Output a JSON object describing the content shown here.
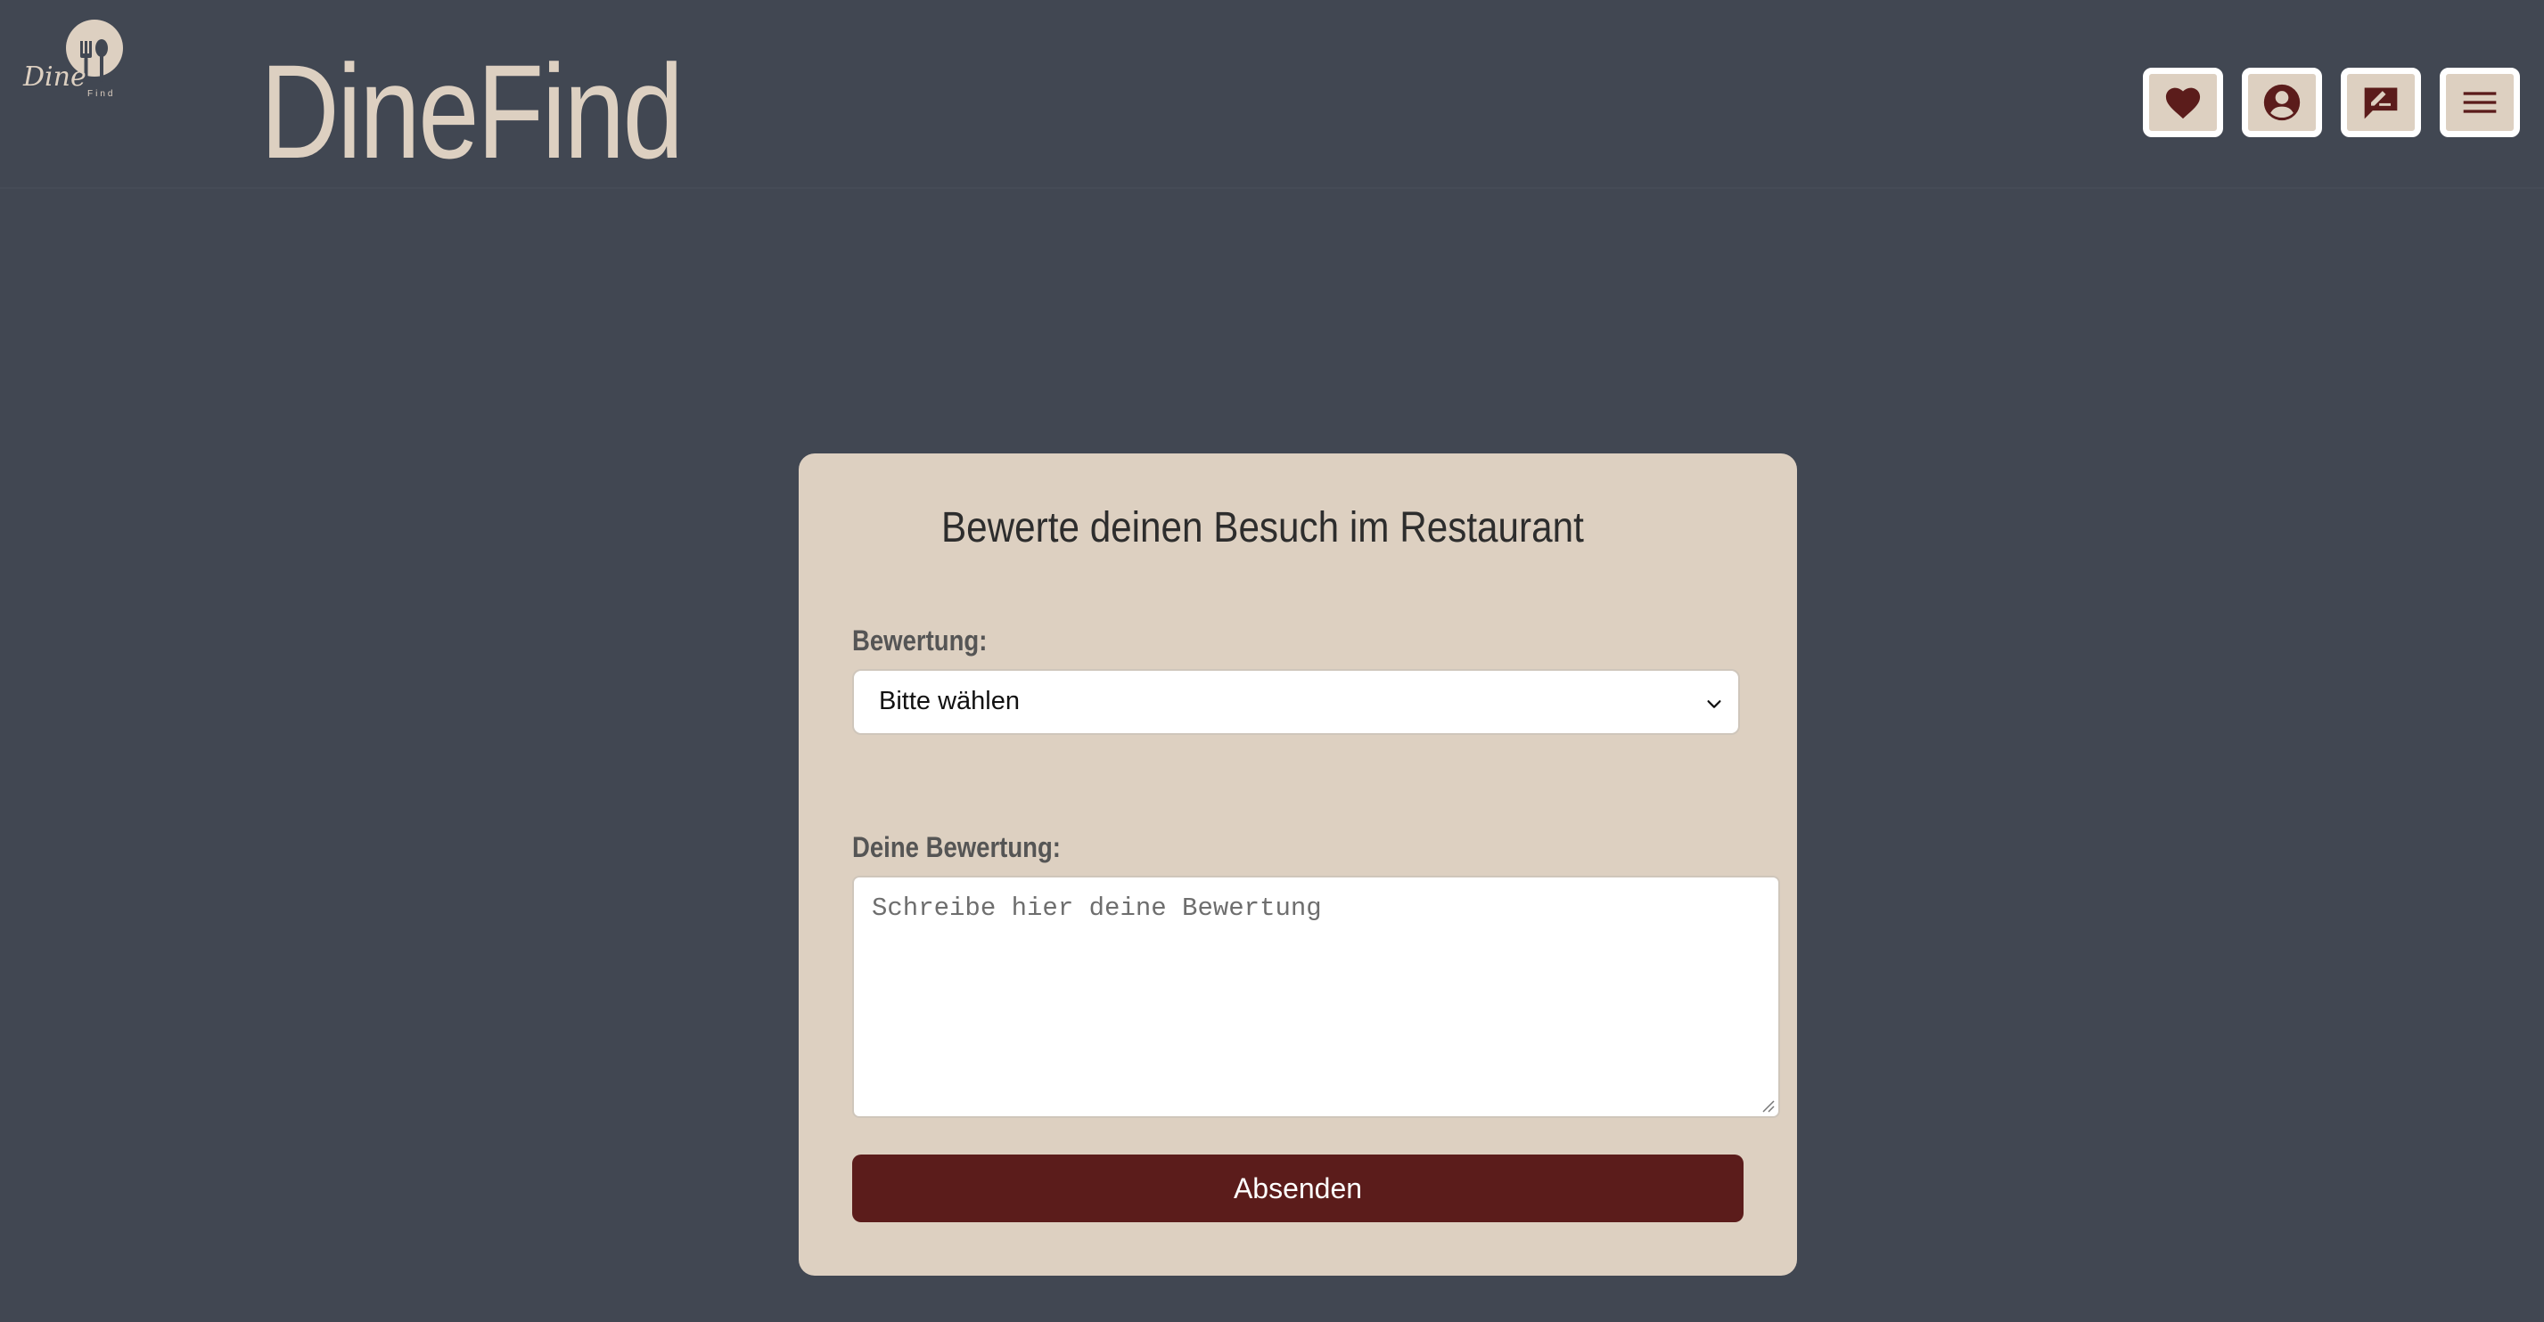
{
  "header": {
    "brand": "DineFind",
    "logo": {
      "script_text": "Dine",
      "small_text": "Find",
      "icon": "fork-spoon-plate-logo-icon"
    },
    "nav": [
      {
        "name": "favorites",
        "icon": "heart-icon"
      },
      {
        "name": "account",
        "icon": "user-circle-icon"
      },
      {
        "name": "reviews",
        "icon": "write-review-icon"
      },
      {
        "name": "menu",
        "icon": "hamburger-menu-icon"
      }
    ]
  },
  "form": {
    "title": "Bewerte deinen Besuch im Restaurant",
    "rating_label": "Bewertung:",
    "rating_select_value": "Bitte wählen",
    "review_label": "Deine Bewertung:",
    "review_placeholder": "Schreibe hier deine Bewertung",
    "review_value": "",
    "submit_label": "Absenden"
  },
  "colors": {
    "background": "#414752",
    "card": "#ddd0c1",
    "accent": "#5b1c1b",
    "brand_text": "#ddd0c1"
  }
}
